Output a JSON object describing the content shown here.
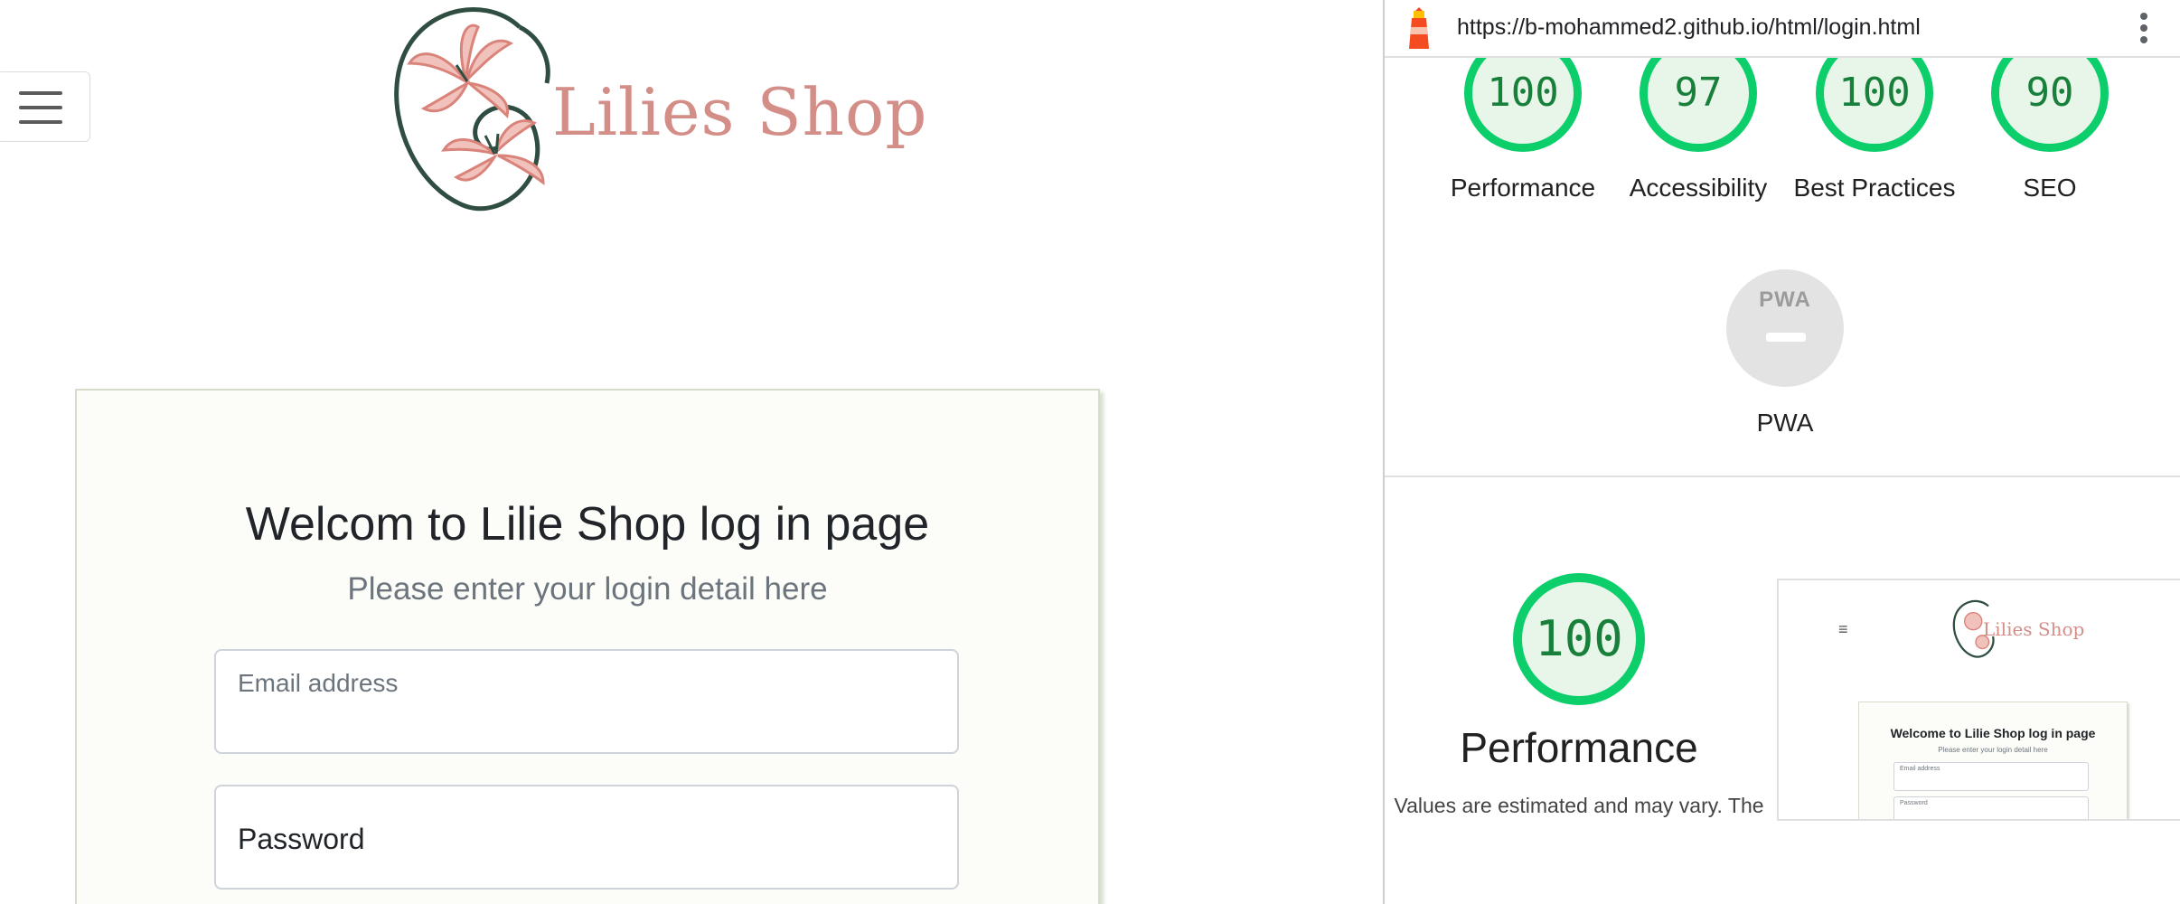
{
  "site": {
    "brand": "Lilies Shop",
    "login_title": "Welcom to Lilie Shop log in page",
    "login_subtitle": "Please enter your login detail here",
    "email_label": "Email address",
    "password_label": "Password"
  },
  "lighthouse": {
    "url": "https://b-mohammed2.github.io/html/login.html",
    "scores": [
      {
        "value": "100",
        "label": "Performance"
      },
      {
        "value": "97",
        "label": "Accessibility"
      },
      {
        "value": "100",
        "label": "Best Practices"
      },
      {
        "value": "90",
        "label": "SEO"
      }
    ],
    "pwa": {
      "logo": "PWA",
      "label": "PWA"
    },
    "performance": {
      "score": "100",
      "title": "Performance",
      "description": "Values are estimated and may vary. The"
    },
    "thumbnail": {
      "brand": "Lilies Shop",
      "title": "Welcome to Lilie Shop log in page",
      "subtitle": "Please enter your login detail here",
      "email_label": "Email address",
      "password_label": "Password"
    },
    "colors": {
      "pass": "#0cce6b",
      "pass_text": "#18803b",
      "pass_bg": "#e8f6ea"
    }
  },
  "icons": [
    "hamburger-icon",
    "lighthouse-icon",
    "kebab-menu-icon",
    "lily-logo-icon"
  ]
}
